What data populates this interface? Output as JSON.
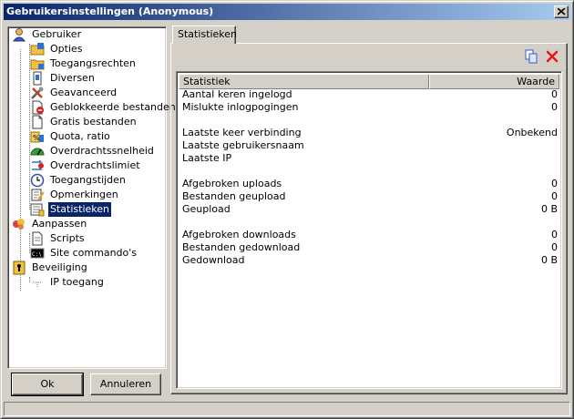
{
  "window": {
    "title": "Gebruikersinstellingen (Anonymous)"
  },
  "tree": {
    "items": [
      {
        "label": "Gebruiker",
        "icon": "user-icon"
      },
      {
        "label": "Opties",
        "icon": "options-icon"
      },
      {
        "label": "Toegangsrechten",
        "icon": "folder-permissions-icon"
      },
      {
        "label": "Diversen",
        "icon": "misc-icon"
      },
      {
        "label": "Geavanceerd",
        "icon": "tools-icon"
      },
      {
        "label": "Geblokkeerde bestanden",
        "icon": "blocked-file-icon"
      },
      {
        "label": "Gratis bestanden",
        "icon": "file-icon"
      },
      {
        "label": "Quota, ratio",
        "icon": "quota-icon"
      },
      {
        "label": "Overdrachtssnelheid",
        "icon": "speed-gauge-icon"
      },
      {
        "label": "Overdrachtslimiet",
        "icon": "limit-icon"
      },
      {
        "label": "Toegangstijden",
        "icon": "clock-icon"
      },
      {
        "label": "Opmerkingen",
        "icon": "notes-icon"
      },
      {
        "label": "Statistieken",
        "icon": "statistics-icon"
      },
      {
        "label": "Aanpassen",
        "icon": "customize-icon"
      },
      {
        "label": "Scripts",
        "icon": "script-icon"
      },
      {
        "label": "Site commando's",
        "icon": "console-icon"
      },
      {
        "label": "Beveiliging",
        "icon": "security-icon"
      },
      {
        "label": "IP toegang",
        "icon": "network-icon"
      }
    ],
    "selected": "Statistieken"
  },
  "buttons": {
    "ok": "Ok",
    "cancel": "Annuleren"
  },
  "tab": {
    "label": "Statistieken"
  },
  "toolbar": {
    "copy_icon": "copy-icon",
    "delete_icon": "delete-icon"
  },
  "list": {
    "columns": [
      "Statistiek",
      "Waarde"
    ],
    "rows": [
      {
        "key": "Aantal keren ingelogd",
        "value": "0"
      },
      {
        "key": "Mislukte inlogpogingen",
        "value": "0"
      },
      {
        "key": "",
        "value": ""
      },
      {
        "key": "Laatste keer verbinding",
        "value": "Onbekend"
      },
      {
        "key": "Laatste gebruikersnaam",
        "value": ""
      },
      {
        "key": "Laatste IP",
        "value": ""
      },
      {
        "key": "",
        "value": ""
      },
      {
        "key": "Afgebroken uploads",
        "value": "0"
      },
      {
        "key": "Bestanden geupload",
        "value": "0"
      },
      {
        "key": "Geupload",
        "value": "0 B"
      },
      {
        "key": "",
        "value": ""
      },
      {
        "key": "Afgebroken downloads",
        "value": "0"
      },
      {
        "key": "Bestanden gedownload",
        "value": "0"
      },
      {
        "key": "Gedownload",
        "value": "0 B"
      }
    ]
  }
}
